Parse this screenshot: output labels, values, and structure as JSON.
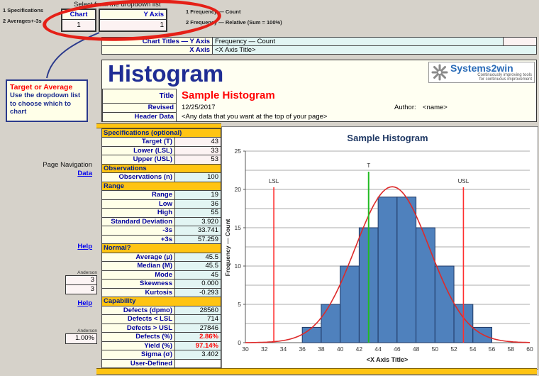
{
  "top": {
    "select_hint": "Select from the dropdown list",
    "left_labels": [
      "1 Specifications",
      "2 Averages+-3s"
    ],
    "right_labels": [
      "1 Frequency — Count",
      "2 Frequency — Relative  (Sum = 100%)"
    ],
    "chart_dropdown": {
      "label": "Chart",
      "value": "1"
    },
    "yaxis_dropdown": {
      "label": "Y Axis",
      "value": "1"
    }
  },
  "chart_titles": {
    "y_axis_label": "Chart Titles — Y Axis",
    "y_axis_value": "Frequency — Count",
    "x_axis_label": "X Axis",
    "x_axis_value": "<X Axis Title>"
  },
  "header": {
    "app_title": "Histogram",
    "logo_text": "Systems2win",
    "logo_tagline1": "Continuously improving tools",
    "logo_tagline2": "for continuous improvement",
    "title_label": "Title",
    "title_value": "Sample Histogram",
    "revised_label": "Revised",
    "revised_value": "12/25/2017",
    "author_label": "Author:",
    "author_value": "<name>",
    "header_data_label": "Header Data",
    "header_data_value": "<Any data that you want at the top of your page>"
  },
  "note": {
    "title": "Target or Average",
    "body": "Use the dropdown list to choose which to chart"
  },
  "nav": {
    "page_navigation": "Page Navigation",
    "data_link": "Data",
    "help_link1": "Help",
    "help_link2": "Help"
  },
  "side_inputs": {
    "anderson_label1": "Anderson",
    "skew_limit": "3",
    "kurt_limit": "3",
    "anderson_label2": "Anderson",
    "alpha": "1.00%"
  },
  "stats_table": {
    "rows": [
      {
        "t": "h",
        "label": "Specifications (optional)"
      },
      {
        "t": "d",
        "label": "Target (T)",
        "value": "43",
        "vclass": "pink"
      },
      {
        "t": "d",
        "label": "Lower (LSL)",
        "value": "33",
        "vclass": "pink"
      },
      {
        "t": "d",
        "label": "Upper (USL)",
        "value": "53",
        "vclass": "pink"
      },
      {
        "t": "h",
        "label": "Observations"
      },
      {
        "t": "d",
        "label": "Observations (n)",
        "value": "100",
        "vclass": "cyan"
      },
      {
        "t": "h",
        "label": "Range"
      },
      {
        "t": "d",
        "label": "Range",
        "value": "19",
        "vclass": "cyan"
      },
      {
        "t": "d",
        "label": "Low",
        "value": "36",
        "vclass": "cyan"
      },
      {
        "t": "d",
        "label": "High",
        "value": "55",
        "vclass": "cyan"
      },
      {
        "t": "d",
        "label": "Standard Deviation",
        "value": "3.920",
        "vclass": "cyan"
      },
      {
        "t": "d",
        "label": "-3s",
        "value": "33.741",
        "vclass": "cyan"
      },
      {
        "t": "d",
        "label": "+3s",
        "value": "57.259",
        "vclass": "cyan"
      },
      {
        "t": "h",
        "label": "Normal?"
      },
      {
        "t": "d",
        "label": "Average (µ)",
        "value": "45.5",
        "vclass": "cyan"
      },
      {
        "t": "d",
        "label": "Median (M)",
        "value": "45.5",
        "vclass": "cyan"
      },
      {
        "t": "d",
        "label": "Mode",
        "value": "45",
        "vclass": "cyan"
      },
      {
        "t": "d",
        "label": "Skewness",
        "value": "0.000",
        "vclass": "cyan"
      },
      {
        "t": "d",
        "label": "Kurtosis",
        "value": "-0.293",
        "vclass": "cyan"
      },
      {
        "t": "h",
        "label": "Capability"
      },
      {
        "t": "d",
        "label": "Defects (dpmo)",
        "value": "28560",
        "vclass": "cyan"
      },
      {
        "t": "d",
        "label": "Defects < LSL",
        "value": "714",
        "vclass": "cyan"
      },
      {
        "t": "d",
        "label": "Defects > USL",
        "value": "27846",
        "vclass": "cyan"
      },
      {
        "t": "d",
        "label": "Defects (%)",
        "value": "2.86%",
        "vclass": "cyan red"
      },
      {
        "t": "d",
        "label": "Yield (%)",
        "value": "97.14%",
        "vclass": "cyan red"
      },
      {
        "t": "d",
        "label": "Sigma (σ)",
        "value": "3.402",
        "vclass": "cyan"
      },
      {
        "t": "d",
        "label": "User-Defined",
        "value": "",
        "vclass": "white"
      }
    ]
  },
  "chart_data": {
    "type": "bar",
    "title": "Sample Histogram",
    "xlabel": "<X Axis Title>",
    "ylabel": "Frequency — Count",
    "xlim": [
      30,
      60
    ],
    "ylim": [
      0,
      25
    ],
    "x_ticks": [
      30,
      32,
      34,
      36,
      38,
      40,
      42,
      44,
      46,
      48,
      50,
      52,
      54,
      56,
      58,
      60
    ],
    "y_ticks": [
      0,
      5,
      10,
      15,
      20,
      25
    ],
    "gridline_step": 2.5,
    "bin_start": 36,
    "bin_width": 2,
    "counts": [
      2,
      5,
      10,
      15,
      19,
      19,
      15,
      10,
      5,
      2
    ],
    "normal_curve": {
      "mean": 45.5,
      "stdev": 3.92,
      "n": 100,
      "peak": 20.35
    },
    "ref_lines": [
      {
        "label": "LSL",
        "x": 33,
        "color": "#FF2E2E"
      },
      {
        "label": "T",
        "x": 43,
        "color": "#22BB22"
      },
      {
        "label": "USL",
        "x": 53,
        "color": "#FF2E2E"
      }
    ],
    "bar_color": "#4F81BD",
    "bar_border": "#1F3864",
    "curve_color": "#DD2A2A",
    "grid": true,
    "legend": "none"
  }
}
